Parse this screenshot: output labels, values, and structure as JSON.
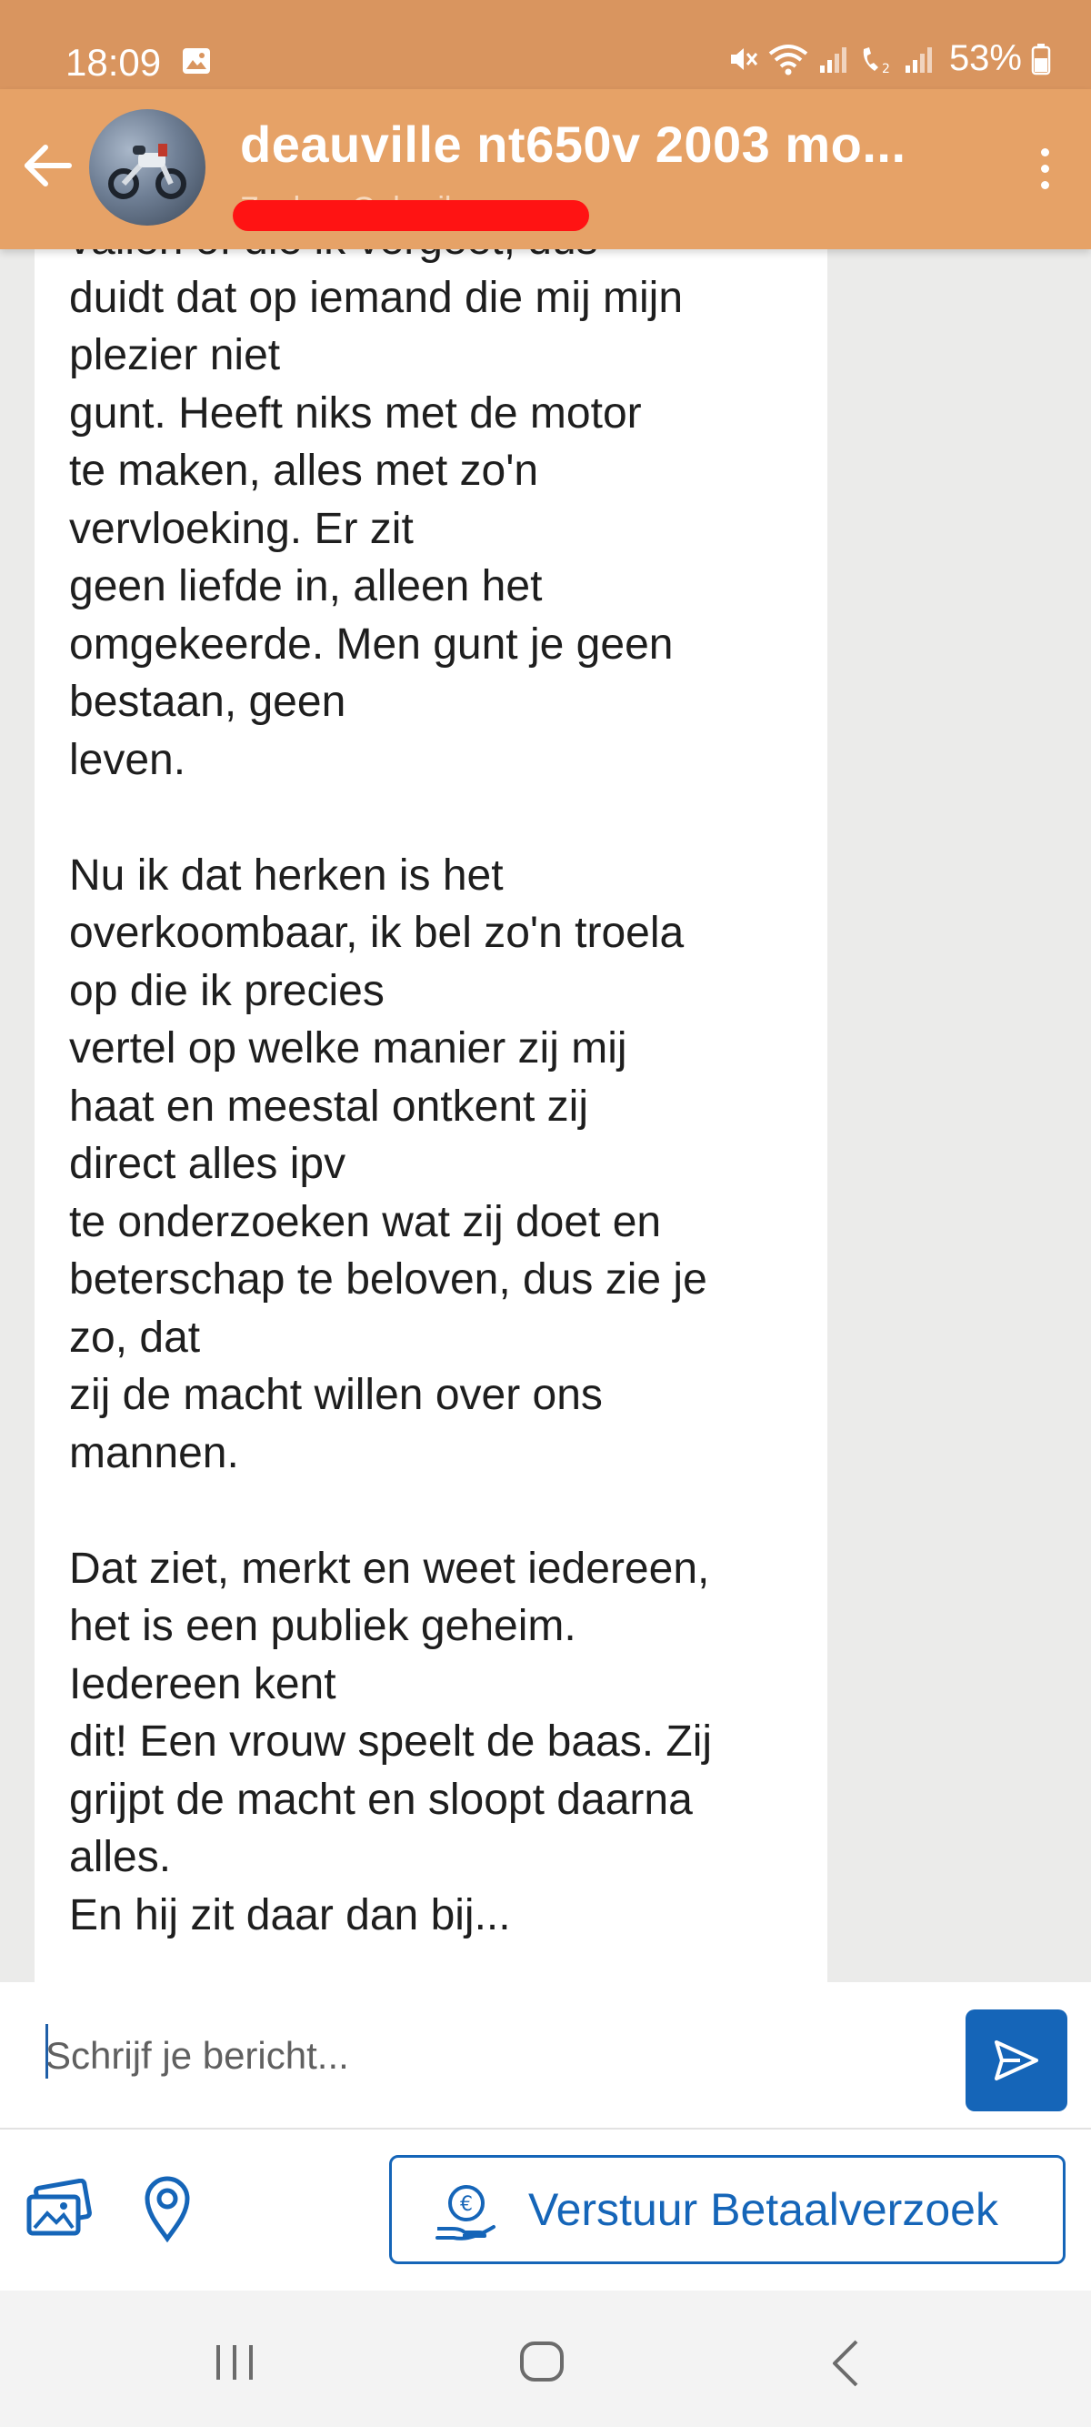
{
  "status_bar": {
    "time": "18:09",
    "battery": "53%",
    "icons": [
      "image-notification-icon",
      "mute-icon",
      "wifi-icon",
      "signal-icon",
      "volte-call-icon",
      "signal-icon",
      "battery-icon"
    ]
  },
  "header": {
    "title": "deauville nt650v  2003 mo...",
    "subtitle": "Zoeken Gebruiker",
    "subtitle_redacted": true,
    "accent_color": "#e6a267"
  },
  "message": {
    "paragraphs": [
      [
        "vallen of die ik vergeet, dus",
        "duidt dat op iemand die mij mijn",
        "plezier niet",
        "gunt. Heeft niks met de motor",
        "te maken, alles met zo'n",
        "vervloeking. Er zit",
        "geen liefde in, alleen het",
        "omgekeerde. Men gunt je geen",
        "bestaan, geen",
        "leven."
      ],
      [
        "Nu ik dat herken is het",
        "overkoombaar, ik bel zo'n troela",
        "op die ik precies",
        "vertel op welke manier zij mij",
        "haat en meestal ontkent zij",
        "direct alles ipv",
        "te onderzoeken wat zij doet en",
        "beterschap te beloven, dus zie je",
        "zo, dat",
        "zij de macht willen over ons",
        "mannen."
      ],
      [
        "Dat ziet, merkt en weet iedereen,",
        "het is een publiek geheim.",
        "Iedereen kent",
        "dit! Een vrouw speelt de baas. Zij",
        "grijpt de macht en sloopt daarna",
        "alles.",
        "En hij zit daar dan bij..."
      ]
    ]
  },
  "compose": {
    "placeholder": "Schrijf je bericht...",
    "value": ""
  },
  "actions": {
    "payment_request_label": "Verstuur Betaalverzoek",
    "brand_color": "#1565b8"
  }
}
